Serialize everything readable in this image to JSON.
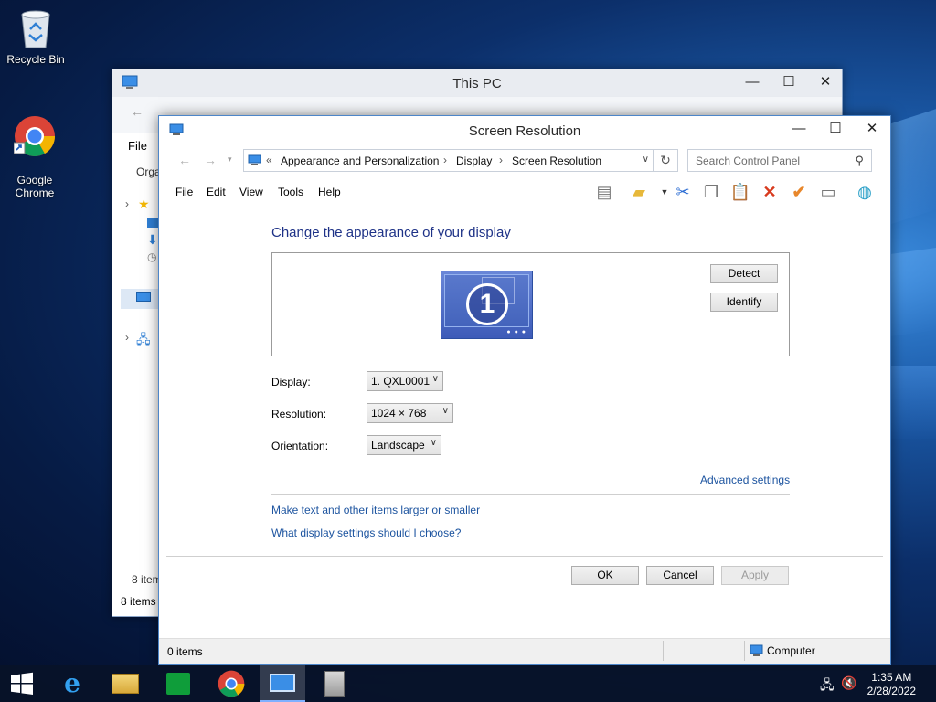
{
  "desktop": {
    "icons": [
      {
        "label": "Recycle Bin"
      },
      {
        "label": "Google\nChrome"
      }
    ]
  },
  "this_pc": {
    "title": "This PC",
    "file_tab": "File",
    "organize": "Orga",
    "status_count": "8 item",
    "status_items": "8 items"
  },
  "window": {
    "title": "Screen Resolution",
    "breadcrumb": [
      "«",
      "Appearance and Personalization",
      "Display",
      "Screen Resolution"
    ],
    "search_placeholder": "Search Control Panel",
    "menu": [
      "File",
      "Edit",
      "View",
      "Tools",
      "Help"
    ],
    "heading": "Change the appearance of your display",
    "monitor_number": "1",
    "detect": "Detect",
    "identify": "Identify",
    "display_label": "Display:",
    "display_value": "1. QXL0001",
    "resolution_label": "Resolution:",
    "resolution_value": "1024 × 768",
    "orientation_label": "Orientation:",
    "orientation_value": "Landscape",
    "advanced": "Advanced settings",
    "link_text_size": "Make text and other items larger or smaller",
    "link_choose": "What display settings should I choose?",
    "ok": "OK",
    "cancel": "Cancel",
    "apply": "Apply",
    "status_items": "0 items",
    "status_computer": "Computer"
  },
  "taskbar": {
    "time": "1:35 AM",
    "date": "2/28/2022"
  }
}
